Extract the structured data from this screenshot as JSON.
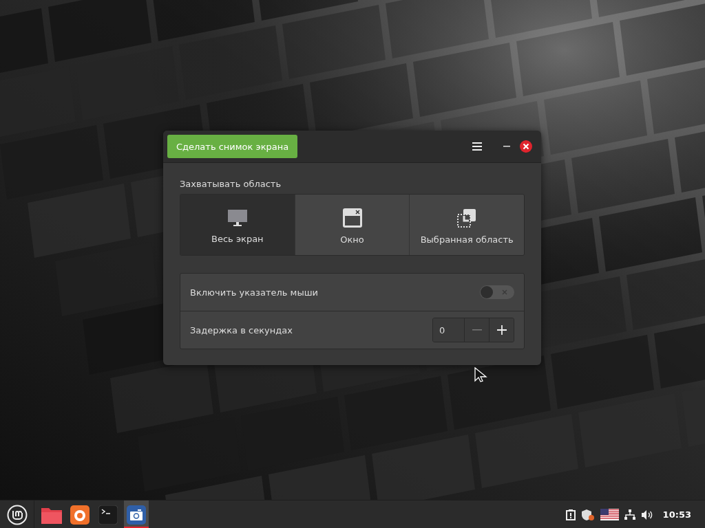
{
  "window": {
    "capture_button": "Сделать снимок экрана"
  },
  "capture_area": {
    "label": "Захватывать область",
    "options": [
      {
        "label": "Весь экран",
        "selected": true,
        "kind": "screen"
      },
      {
        "label": "Окно",
        "selected": false,
        "kind": "window"
      },
      {
        "label": "Выбранная область",
        "selected": false,
        "kind": "area"
      }
    ]
  },
  "settings": [
    {
      "kind": "switch",
      "label": "Включить указатель мыши",
      "on": false
    },
    {
      "kind": "spin",
      "label": "Задержка в секундах",
      "value": "0"
    }
  ],
  "taskbar": {
    "apps": [
      {
        "kind": "files",
        "selected": false
      },
      {
        "kind": "browser",
        "selected": false
      },
      {
        "kind": "terminal",
        "selected": false
      },
      {
        "kind": "screenshot",
        "selected": true
      }
    ],
    "clock": "10:53"
  }
}
